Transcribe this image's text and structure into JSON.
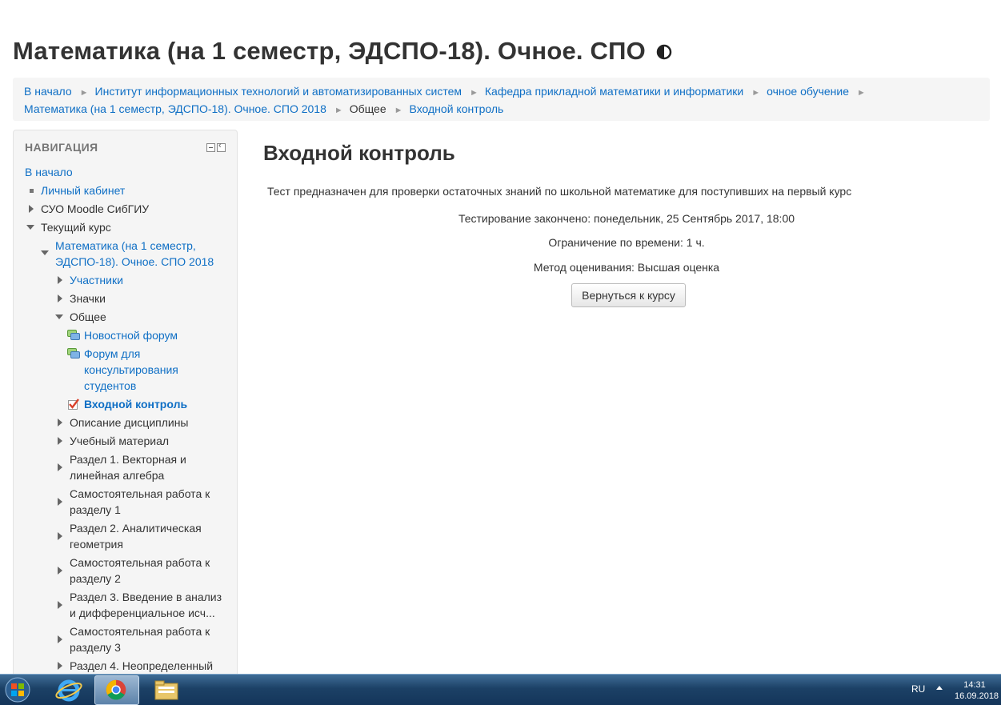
{
  "page_title": "Математика (на 1 семестр, ЭДСПО-18). Очное. СПО",
  "breadcrumb": {
    "items": [
      "В начало",
      "Институт информационных технологий и автоматизированных систем",
      "Кафедра прикладной математики и информатики",
      "очное обучение",
      "Математика (на 1 семестр, ЭДСПО-18). Очное. СПО 2018",
      "Общее",
      "Входной контроль"
    ]
  },
  "nav_block": {
    "title": "НАВИГАЦИЯ",
    "home": "В начало",
    "dashboard": "Личный кабинет",
    "site": "СУО Moodle СибГИУ",
    "current_course": "Текущий курс",
    "course_line1": "Математика (на 1 семестр,",
    "course_line2": "ЭДСПО-18). Очное. СПО 2018",
    "participants": "Участники",
    "badges": "Значки",
    "general": "Общее",
    "news_forum": "Новостной форум",
    "consult_forum_l1": "Форум для",
    "consult_forum_l2": "консультирования",
    "consult_forum_l3": "студентов",
    "entry_quiz": "Входной контроль",
    "sections": [
      [
        "Описание дисциплины"
      ],
      [
        "Учебный материал"
      ],
      [
        "Раздел 1. Векторная и",
        "линейная алгебра"
      ],
      [
        "Самостоятельная работа к",
        "разделу 1"
      ],
      [
        "Раздел 2. Аналитическая",
        "геометрия"
      ],
      [
        "Самостоятельная работа к",
        "разделу 2"
      ],
      [
        "Раздел 3. Введение в анализ",
        "и дифференциальное исч..."
      ],
      [
        "Самостоятельная работа к",
        "разделу 3"
      ],
      [
        "Раздел 4. Неопределенный"
      ]
    ]
  },
  "main": {
    "heading": "Входной контроль",
    "intro": "Тест предназначен для проверки остаточных знаний по школьной математике для поступивших  на первый курс",
    "closed": "Тестирование закончено: понедельник, 25 Сентябрь 2017, 18:00",
    "time_limit": "Ограничение по времени: 1 ч.",
    "grading": "Метод оценивания: Высшая оценка",
    "back_button": "Вернуться к курсу"
  },
  "taskbar": {
    "lang": "RU",
    "time": "14:31",
    "date": "16.09.2018"
  },
  "colors": {
    "link": "#0f6fc5",
    "breadcrumb_bg": "#f5f5f5",
    "taskbar": "#1c4166"
  }
}
